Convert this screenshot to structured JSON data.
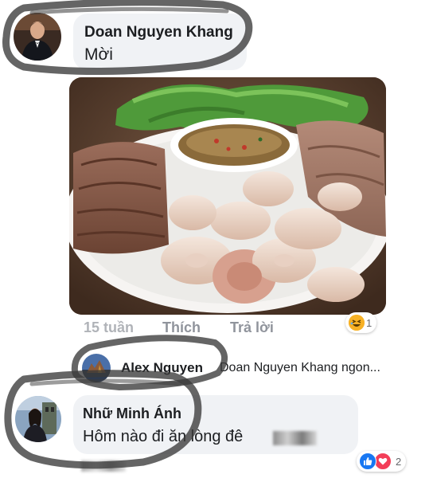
{
  "post_comment": {
    "author": "Doan Nguyen Khang",
    "text": "Mời",
    "photo_alt": "",
    "time": "15 tuần",
    "like_label": "Thích",
    "reply_label": "Trả lời",
    "reaction_count": "1",
    "reaction_emoji": "😆"
  },
  "reply_preview": {
    "author": "Alex Nguyen",
    "text": "Doan Nguyen Khang ngon..."
  },
  "second_comment": {
    "author": "Nhữ Minh Ánh",
    "text": "Hôm nào đi ăn lòng đê",
    "reaction_count": "2"
  },
  "colors": {
    "bubble": "#f0f2f5",
    "action_text": "#90949c",
    "like_blue": "#1877f2",
    "love_red": "#f33e58",
    "haha_yellow": "#f7b125",
    "marker": "#3a3a3a"
  },
  "icons": [
    "avatar-doan",
    "avatar-alex",
    "avatar-nhu",
    "haha-icon",
    "like-icon",
    "love-icon"
  ]
}
